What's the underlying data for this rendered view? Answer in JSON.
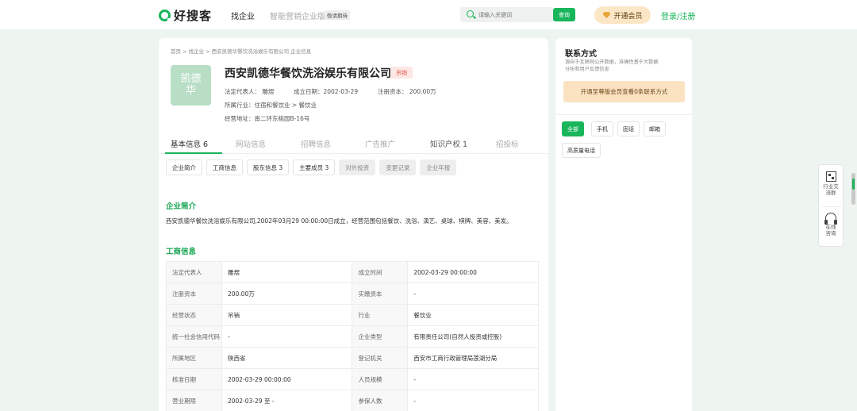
{
  "header": {
    "logo_text": "好搜客",
    "nav_find": "找企业",
    "nav_smart": "智能营销企业版",
    "nav_badge": "敬请期待",
    "search_placeholder": "请输入关键词",
    "search_button": "查询",
    "vip_button": "开通会员",
    "login_link": "登录/注册"
  },
  "breadcrumb": "首页 > 找企业 > 西安凯德华餐饮洗浴娱乐有限公司 企业信息",
  "company": {
    "avatar_text": "凯德华",
    "name": "西安凯德华餐饮洗浴娱乐有限公司",
    "status": "吊销",
    "legal_rep": "法定代表人：  雕煜",
    "established": "成立日期：2002-03-29",
    "capital": "注册资本：  200.00万",
    "industry": "所属行业：住宿和餐饮业 > 餐饮业",
    "address": "经营地址：南二环东桃园B-16号"
  },
  "tabs": [
    {
      "label": "基本信息 6"
    },
    {
      "label": "网站信息"
    },
    {
      "label": "招聘信息"
    },
    {
      "label": "广告推广"
    },
    {
      "label": "知识产权 1"
    },
    {
      "label": "招投标"
    }
  ],
  "subtabs": [
    {
      "label": "企业简介"
    },
    {
      "label": "工商信息"
    },
    {
      "label": "股东信息 3"
    },
    {
      "label": "主要成员 3"
    },
    {
      "label": "对外投资"
    },
    {
      "label": "变更记录"
    },
    {
      "label": "企业年报"
    }
  ],
  "intro": {
    "title": "企业简介",
    "text": "西安凯德华餐饮洗浴娱乐有限公司,2002年03月29 00:00:00日成立，经营范围包括餐饮、洗浴、演艺、桌球、棋牌、美容、美发。"
  },
  "business": {
    "title": "工商信息",
    "rows": [
      [
        "法定代表人",
        "雕煜",
        "成立时间",
        "2002-03-29 00:00:00"
      ],
      [
        "注册资本",
        "200.00万",
        "实缴资本",
        "-"
      ],
      [
        "经营状态",
        "吊销",
        "行业",
        "餐饮业"
      ],
      [
        "统一社会信用代码",
        "-",
        "企业类型",
        "有限责任公司(自然人投资或控股)"
      ],
      [
        "所属地区",
        "陕西省",
        "登记机关",
        "西安市工商行政管理局莲湖分局"
      ],
      [
        "核准日期",
        "2002-03-29 00:00:00",
        "人员规模",
        "-"
      ],
      [
        "营业期限",
        "2002-03-29 至 -",
        "参保人数",
        "-"
      ]
    ]
  },
  "contact": {
    "title": "联系方式",
    "desc": "源自于互联网公开数据，准确性基于大数据分析和用户反馈信息",
    "upgrade": "开通至尊版会员查看0条联系方式",
    "filters": [
      "全部",
      "手机",
      "固话",
      "邮箱",
      "高质量电话"
    ]
  },
  "float": {
    "group": "行业交流群",
    "consult": "在线咨询"
  },
  "colors": {
    "brand": "#19b55b",
    "status_red": "#e3574b",
    "vip_gold": "#fbe7c6"
  }
}
